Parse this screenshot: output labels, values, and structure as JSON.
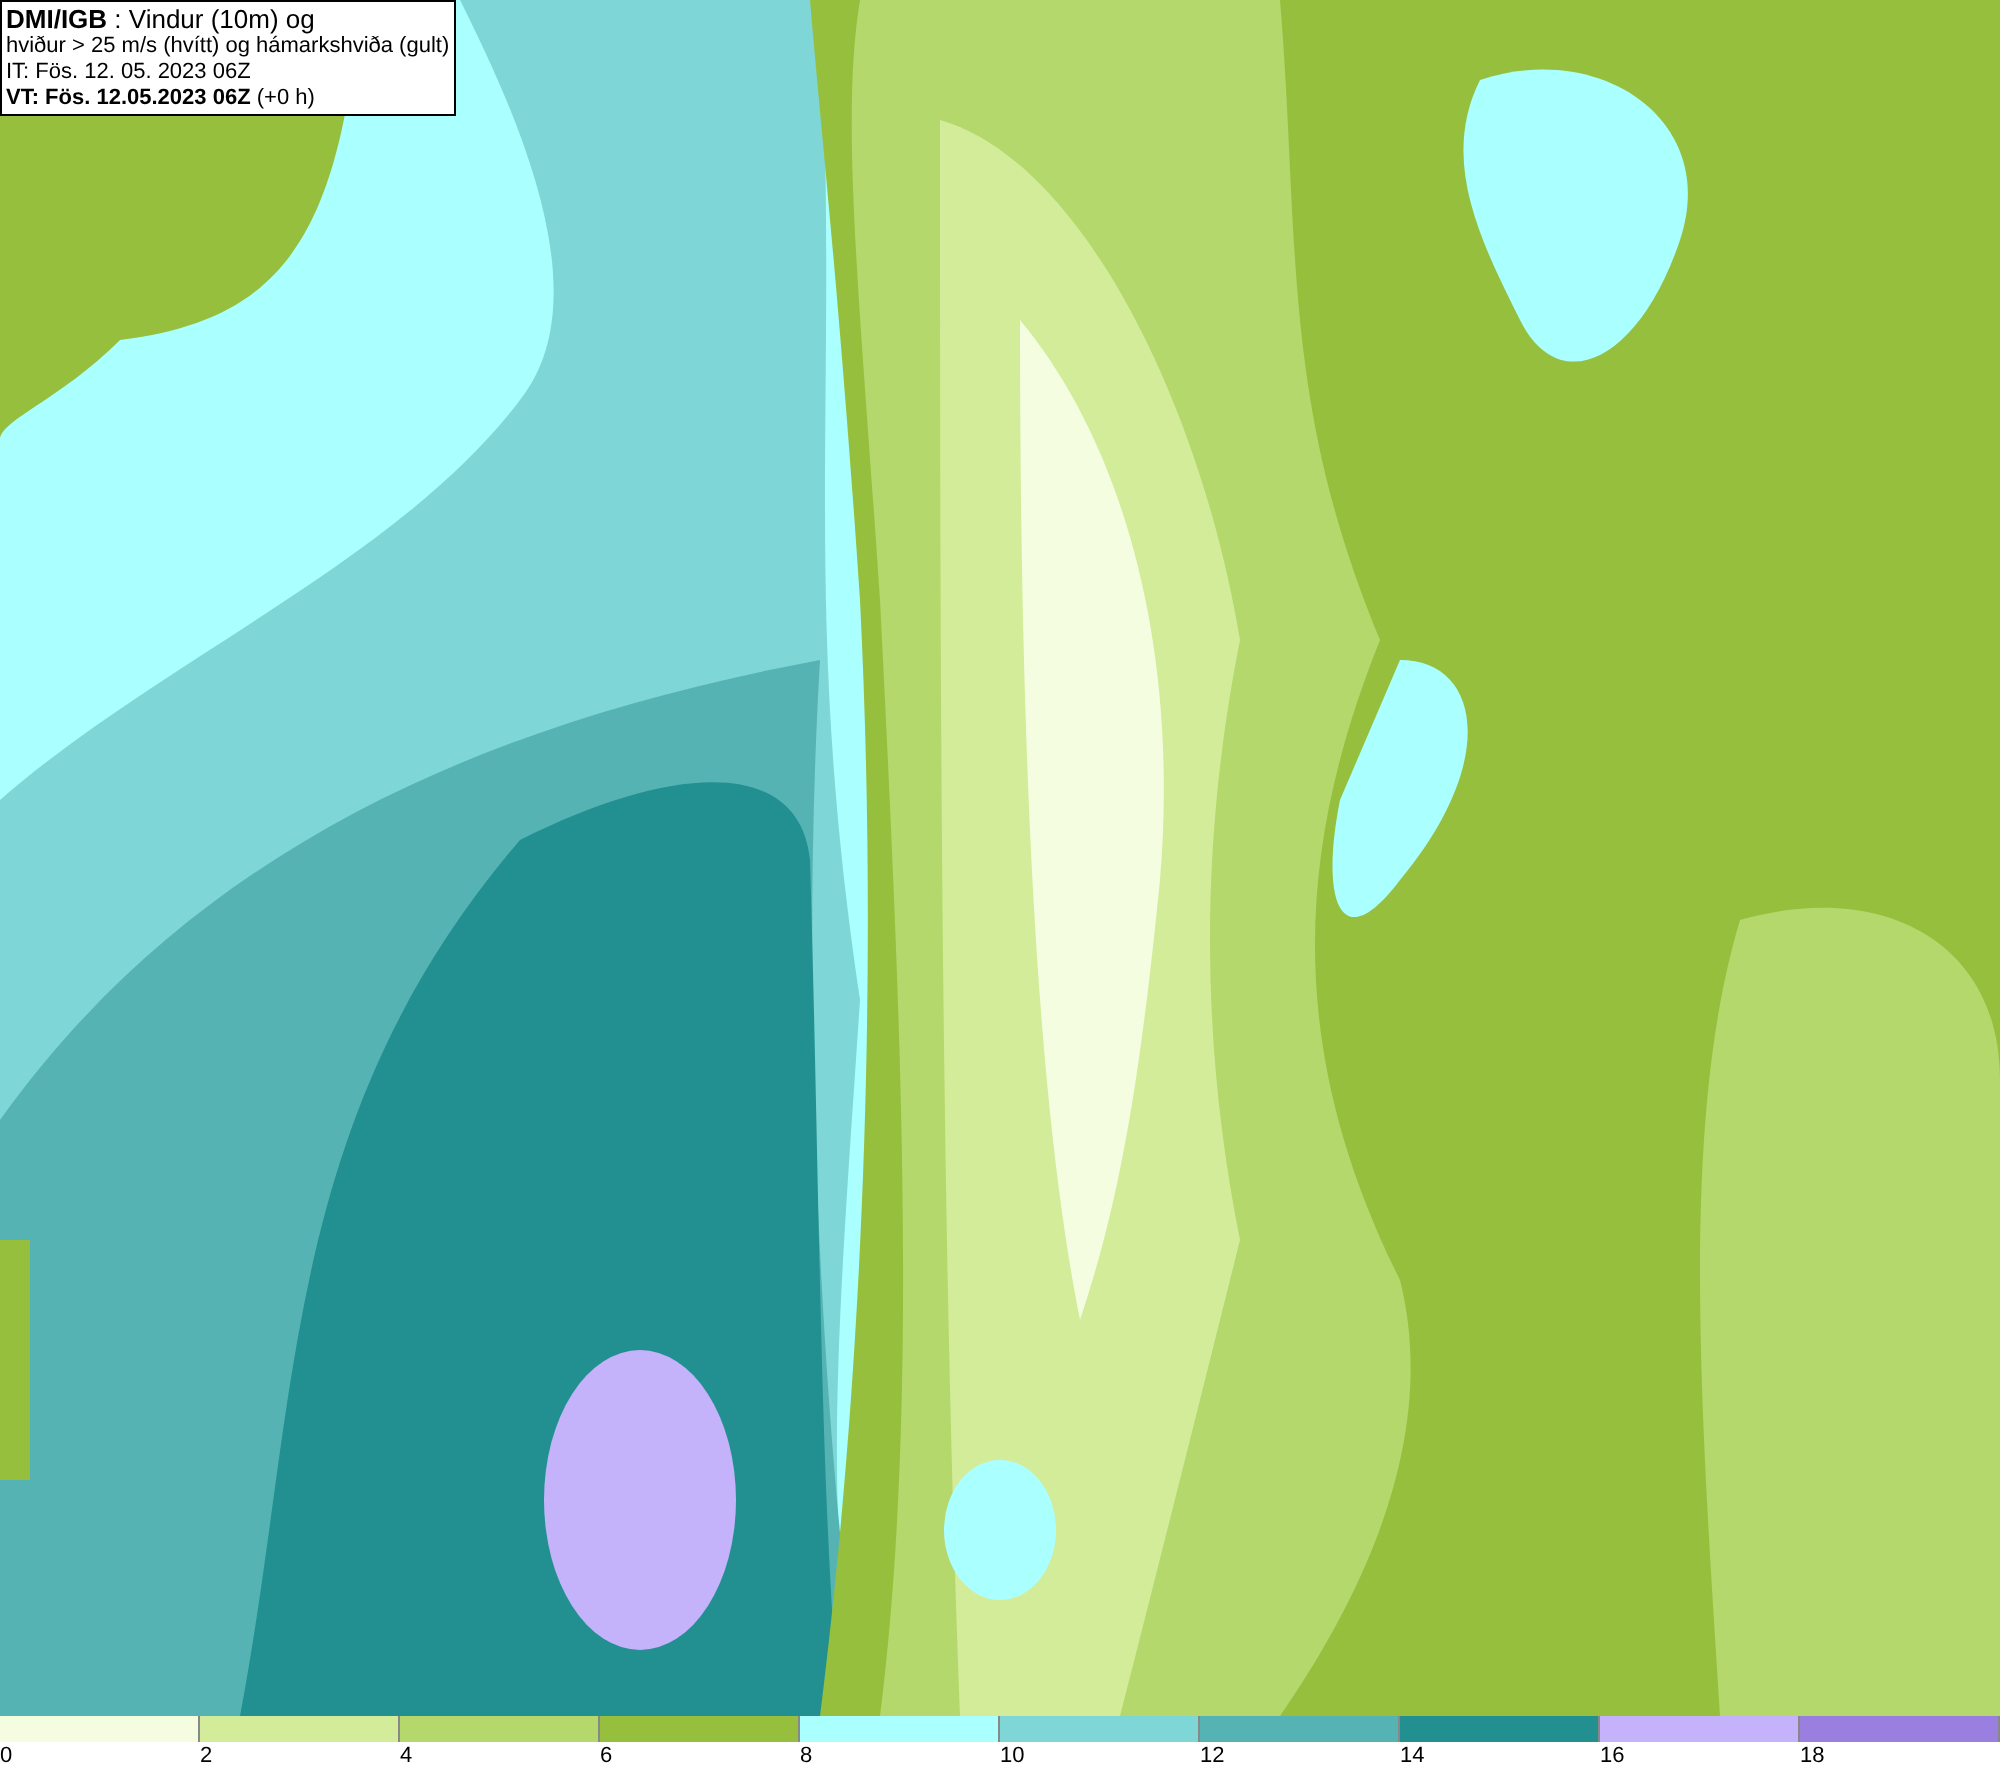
{
  "info_box": {
    "lines": [
      "**DMI/IGB** : Vindur (10m) og",
      "hviður > 25 m/s (hvítt) og hámarkshviða (gult)",
      "IT: Fös. 12. 05. 2023 06Z",
      "**VT: Fös. 12.05.2023 06Z** (+0 h)"
    ]
  },
  "legend": [
    {
      "label": "0",
      "color": "#f4fde0"
    },
    {
      "label": "2",
      "color": "#d3ec9a"
    },
    {
      "label": "4",
      "color": "#b5d86c"
    },
    {
      "label": "6",
      "color": "#96bf3e"
    },
    {
      "label": "8",
      "color": "#aaffff"
    },
    {
      "label": "10",
      "color": "#7fd6d6"
    },
    {
      "label": "12",
      "color": "#55b3b3"
    },
    {
      "label": "14",
      "color": "#229090"
    },
    {
      "label": "16",
      "color": "#c4b3fa"
    },
    {
      "label": "18",
      "color": "#9b7fe0"
    }
  ]
}
